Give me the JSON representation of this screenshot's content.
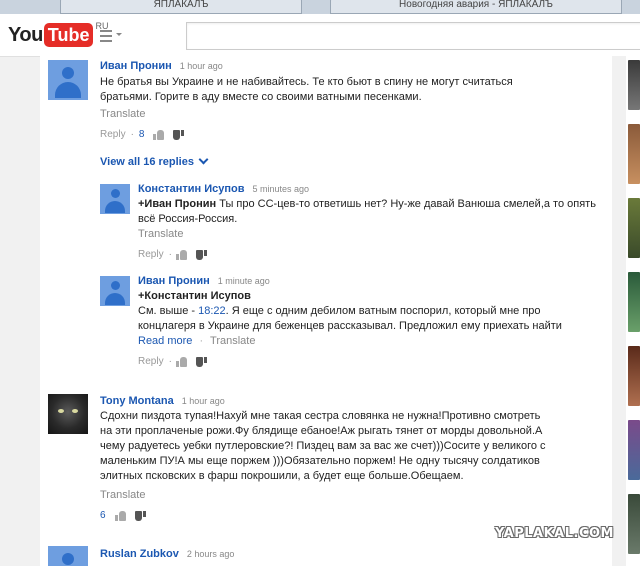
{
  "browser": {
    "tabs": [
      "ЯПЛАКАЛЪ",
      "Новогодняя авария - ЯПЛАКАЛЪ"
    ]
  },
  "header": {
    "logo_you": "You",
    "logo_tube": "Tube",
    "logo_region": "RU",
    "search_placeholder": ""
  },
  "comments": [
    {
      "author": "Иван Пронин",
      "time": "1 hour ago",
      "text": "Не братья вы Украине и не набивайтесь. Те кто бьют в спину не могут считаться братьями. Горите в аду вместе со своими ватными песенками.",
      "translate": "Translate",
      "reply": "Reply",
      "likes": "8"
    },
    {
      "author": "Tony Montana",
      "time": "1 hour ago",
      "text": "Сдохни пиздота тупая!Нахуй мне такая сестра словянка не нужна!Противно смотреть на эти проплаченые рожи.Фу блядище ебаное!Аж рыгать тянет от морды довольной.А чему радуетесь уебки путлеровские?! Пиздец вам за вас же счет)))Сосите  у великого с маленьким ПУ!А мы еще поржем )))Обязательно поржем! Не одну тысячу солдатиков  элитных псковских в фарш покрошили, а будет еще больше.Обещаем.",
      "translate": "Translate",
      "likes": "6"
    },
    {
      "author": "Ruslan Zubkov",
      "time": "2 hours ago"
    }
  ],
  "view_all": "View all 16 replies",
  "replies": [
    {
      "author": "Константин Исупов",
      "time": "5 minutes ago",
      "mention": "+Иван Пронин",
      "text": " Ты про СС-цев-то ответишь нет? Ну-же давай Ванюша смелей,а то опять всё Россия-Россия.",
      "translate": "Translate",
      "reply": "Reply"
    },
    {
      "author": "Иван Пронин",
      "time": "1 minute ago",
      "mention": "+Константин Исупов",
      "text_before": "См. выше - ",
      "timestamp_link": "18:22",
      "text_after": ". Я еще с одним дебилом ватным поспорил, который мне про концлагеря в Украине для беженцев рассказывал. Предложил ему приехать найти",
      "read_more": "Read more",
      "translate": "Translate",
      "reply": "Reply"
    }
  ],
  "watermark": "YAPLAKAL.COM"
}
